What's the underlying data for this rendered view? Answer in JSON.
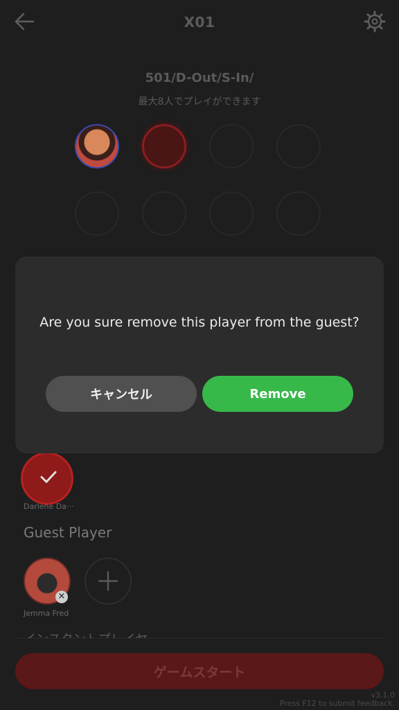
{
  "header": {
    "title": "X01",
    "back_icon": "arrow-left-icon",
    "settings_icon": "gear-icon"
  },
  "game": {
    "mode": "501/D-Out/S-In/",
    "subtitle": "最大8人でプレイができます"
  },
  "dialog": {
    "message": "Are you sure remove this player from the guest?",
    "cancel_label": "キャンセル",
    "remove_label": "Remove"
  },
  "players": {
    "selected_name": "Darlene Da···"
  },
  "guest": {
    "section_title": "Guest Player",
    "player_name": "Jemma Fred"
  },
  "instant": {
    "section_title": "インスタントプレイヤー"
  },
  "footer": {
    "start_label": "ゲームスタート",
    "version": "v3.1.0",
    "feedback": "Press F12 to submit feedback."
  },
  "colors": {
    "accent_green": "#37b94a",
    "start_red": "#5a1818",
    "dialog_bg": "#2c2c2c"
  }
}
